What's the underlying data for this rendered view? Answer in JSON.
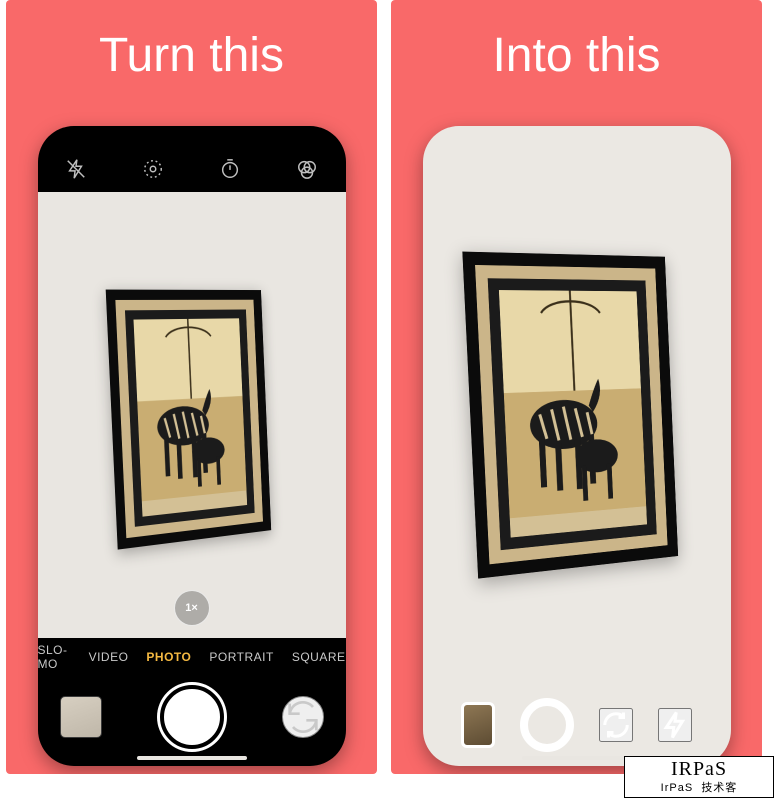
{
  "panel_left_label": "Turn this",
  "panel_right_label": "Into this",
  "left_camera": {
    "zoom_label": "1×",
    "modes": [
      "SLO-MO",
      "VIDEO",
      "PHOTO",
      "PORTRAIT",
      "SQUARE"
    ],
    "active_mode_index": 2,
    "top_icons": [
      "flash-off-icon",
      "live-photo-icon",
      "timer-icon",
      "filters-icon"
    ]
  },
  "right_camera": {
    "buttons": [
      "thumbnail",
      "shutter",
      "rotate",
      "flash"
    ]
  },
  "watermark": {
    "line1": "IRPaS",
    "line2_left": "IrPaS",
    "line2_right": "技术客"
  }
}
